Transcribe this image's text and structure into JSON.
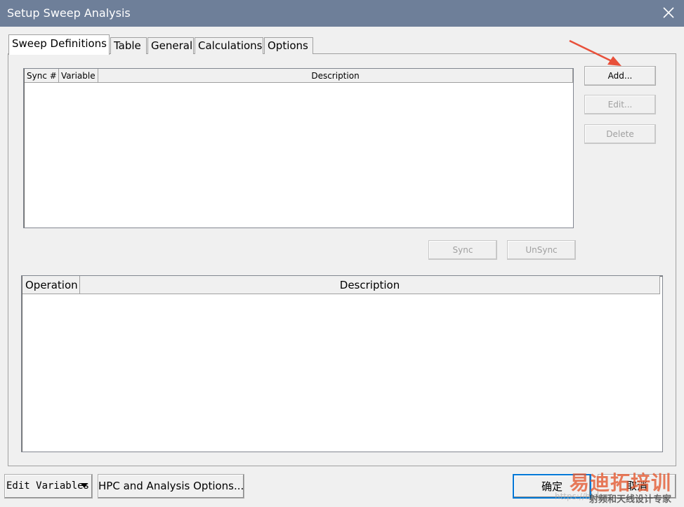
{
  "window": {
    "title": "Setup Sweep Analysis",
    "close_icon": "close-icon"
  },
  "tabs": [
    {
      "label": "Sweep Definitions",
      "active": true
    },
    {
      "label": "Table",
      "active": false
    },
    {
      "label": "General",
      "active": false
    },
    {
      "label": "Calculations",
      "active": false
    },
    {
      "label": "Options",
      "active": false
    }
  ],
  "sweep_list": {
    "columns": [
      "Sync #",
      "Variable",
      "Description"
    ],
    "rows": []
  },
  "side_buttons": {
    "add": "Add...",
    "edit": "Edit...",
    "delete": "Delete"
  },
  "sync_buttons": {
    "sync": "Sync",
    "unsync": "UnSync"
  },
  "operation_list": {
    "columns": [
      "Operation",
      "Description"
    ],
    "rows": []
  },
  "footer": {
    "edit_variables": "Edit Variables",
    "hpc_options": "HPC and Analysis Options...",
    "ok": "确定",
    "cancel": "取消"
  },
  "watermark": {
    "brand": "易迪拓培训",
    "tagline": "射频和天线设计专家",
    "url": "https://blog.c"
  },
  "annotation": {
    "arrow_color": "#e8503a"
  },
  "colors": {
    "titlebar": "#6e7f99",
    "dialog_bg": "#f0f0f0",
    "disabled_text": "#a0a0a0"
  }
}
